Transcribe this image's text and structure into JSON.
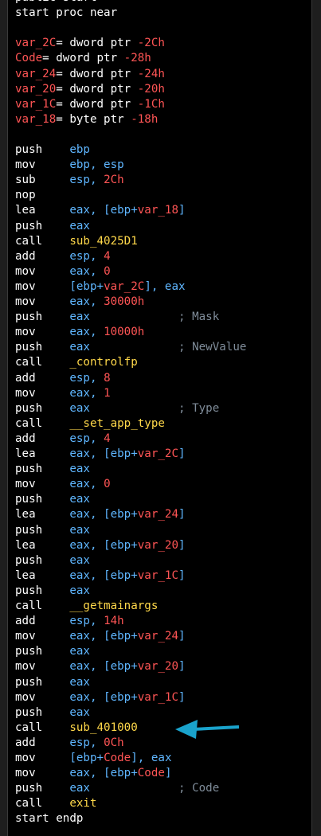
{
  "colors": {
    "background": "#000000",
    "text": "#ffffff",
    "variable": "#ff5555",
    "number": "#ff5555",
    "operand": "#5fb6ff",
    "function": "#ffd84a",
    "comment": "#7f8c99",
    "arrow": "#1aa3cc"
  },
  "lines": [
    [
      {
        "t": "public start",
        "c": "w"
      }
    ],
    [
      {
        "t": "start proc near",
        "c": "w"
      }
    ],
    [],
    [
      {
        "t": "var_2C",
        "c": "r"
      },
      {
        "t": "= dword ptr ",
        "c": "w"
      },
      {
        "t": "-2Ch",
        "c": "r"
      }
    ],
    [
      {
        "t": "Code",
        "c": "r"
      },
      {
        "t": "= dword ptr ",
        "c": "w"
      },
      {
        "t": "-28h",
        "c": "r"
      }
    ],
    [
      {
        "t": "var_24",
        "c": "r"
      },
      {
        "t": "= dword ptr ",
        "c": "w"
      },
      {
        "t": "-24h",
        "c": "r"
      }
    ],
    [
      {
        "t": "var_20",
        "c": "r"
      },
      {
        "t": "= dword ptr ",
        "c": "w"
      },
      {
        "t": "-20h",
        "c": "r"
      }
    ],
    [
      {
        "t": "var_1C",
        "c": "r"
      },
      {
        "t": "= dword ptr ",
        "c": "w"
      },
      {
        "t": "-1Ch",
        "c": "r"
      }
    ],
    [
      {
        "t": "var_18",
        "c": "r"
      },
      {
        "t": "= byte ptr ",
        "c": "w"
      },
      {
        "t": "-18h",
        "c": "r"
      }
    ],
    [],
    [
      {
        "t": "push    ",
        "c": "w"
      },
      {
        "t": "ebp",
        "c": "b"
      }
    ],
    [
      {
        "t": "mov     ",
        "c": "w"
      },
      {
        "t": "ebp, esp",
        "c": "b"
      }
    ],
    [
      {
        "t": "sub     ",
        "c": "w"
      },
      {
        "t": "esp, ",
        "c": "b"
      },
      {
        "t": "2Ch",
        "c": "r"
      }
    ],
    [
      {
        "t": "nop",
        "c": "w"
      }
    ],
    [
      {
        "t": "lea     ",
        "c": "w"
      },
      {
        "t": "eax, [ebp+",
        "c": "b"
      },
      {
        "t": "var_18",
        "c": "r"
      },
      {
        "t": "]",
        "c": "b"
      }
    ],
    [
      {
        "t": "push    ",
        "c": "w"
      },
      {
        "t": "eax",
        "c": "b"
      }
    ],
    [
      {
        "t": "call    ",
        "c": "w"
      },
      {
        "t": "sub_4025D1",
        "c": "y"
      }
    ],
    [
      {
        "t": "add     ",
        "c": "w"
      },
      {
        "t": "esp, ",
        "c": "b"
      },
      {
        "t": "4",
        "c": "r"
      }
    ],
    [
      {
        "t": "mov     ",
        "c": "w"
      },
      {
        "t": "eax, ",
        "c": "b"
      },
      {
        "t": "0",
        "c": "r"
      }
    ],
    [
      {
        "t": "mov     ",
        "c": "w"
      },
      {
        "t": "[ebp+",
        "c": "b"
      },
      {
        "t": "var_2C",
        "c": "r"
      },
      {
        "t": "], eax",
        "c": "b"
      }
    ],
    [
      {
        "t": "mov     ",
        "c": "w"
      },
      {
        "t": "eax, ",
        "c": "b"
      },
      {
        "t": "30000h",
        "c": "r"
      }
    ],
    [
      {
        "t": "push    ",
        "c": "w"
      },
      {
        "t": "eax",
        "c": "b"
      },
      {
        "t": "             ; Mask",
        "c": "g"
      }
    ],
    [
      {
        "t": "mov     ",
        "c": "w"
      },
      {
        "t": "eax, ",
        "c": "b"
      },
      {
        "t": "10000h",
        "c": "r"
      }
    ],
    [
      {
        "t": "push    ",
        "c": "w"
      },
      {
        "t": "eax",
        "c": "b"
      },
      {
        "t": "             ; NewValue",
        "c": "g"
      }
    ],
    [
      {
        "t": "call    ",
        "c": "w"
      },
      {
        "t": "_controlfp",
        "c": "y"
      }
    ],
    [
      {
        "t": "add     ",
        "c": "w"
      },
      {
        "t": "esp, ",
        "c": "b"
      },
      {
        "t": "8",
        "c": "r"
      }
    ],
    [
      {
        "t": "mov     ",
        "c": "w"
      },
      {
        "t": "eax, ",
        "c": "b"
      },
      {
        "t": "1",
        "c": "r"
      }
    ],
    [
      {
        "t": "push    ",
        "c": "w"
      },
      {
        "t": "eax",
        "c": "b"
      },
      {
        "t": "             ; Type",
        "c": "g"
      }
    ],
    [
      {
        "t": "call    ",
        "c": "w"
      },
      {
        "t": "__set_app_type",
        "c": "y"
      }
    ],
    [
      {
        "t": "add     ",
        "c": "w"
      },
      {
        "t": "esp, ",
        "c": "b"
      },
      {
        "t": "4",
        "c": "r"
      }
    ],
    [
      {
        "t": "lea     ",
        "c": "w"
      },
      {
        "t": "eax, [ebp+",
        "c": "b"
      },
      {
        "t": "var_2C",
        "c": "r"
      },
      {
        "t": "]",
        "c": "b"
      }
    ],
    [
      {
        "t": "push    ",
        "c": "w"
      },
      {
        "t": "eax",
        "c": "b"
      }
    ],
    [
      {
        "t": "mov     ",
        "c": "w"
      },
      {
        "t": "eax, ",
        "c": "b"
      },
      {
        "t": "0",
        "c": "r"
      }
    ],
    [
      {
        "t": "push    ",
        "c": "w"
      },
      {
        "t": "eax",
        "c": "b"
      }
    ],
    [
      {
        "t": "lea     ",
        "c": "w"
      },
      {
        "t": "eax, [ebp+",
        "c": "b"
      },
      {
        "t": "var_24",
        "c": "r"
      },
      {
        "t": "]",
        "c": "b"
      }
    ],
    [
      {
        "t": "push    ",
        "c": "w"
      },
      {
        "t": "eax",
        "c": "b"
      }
    ],
    [
      {
        "t": "lea     ",
        "c": "w"
      },
      {
        "t": "eax, [ebp+",
        "c": "b"
      },
      {
        "t": "var_20",
        "c": "r"
      },
      {
        "t": "]",
        "c": "b"
      }
    ],
    [
      {
        "t": "push    ",
        "c": "w"
      },
      {
        "t": "eax",
        "c": "b"
      }
    ],
    [
      {
        "t": "lea     ",
        "c": "w"
      },
      {
        "t": "eax, [ebp+",
        "c": "b"
      },
      {
        "t": "var_1C",
        "c": "r"
      },
      {
        "t": "]",
        "c": "b"
      }
    ],
    [
      {
        "t": "push    ",
        "c": "w"
      },
      {
        "t": "eax",
        "c": "b"
      }
    ],
    [
      {
        "t": "call    ",
        "c": "w"
      },
      {
        "t": "__getmainargs",
        "c": "y"
      }
    ],
    [
      {
        "t": "add     ",
        "c": "w"
      },
      {
        "t": "esp, ",
        "c": "b"
      },
      {
        "t": "14h",
        "c": "r"
      }
    ],
    [
      {
        "t": "mov     ",
        "c": "w"
      },
      {
        "t": "eax, [ebp+",
        "c": "b"
      },
      {
        "t": "var_24",
        "c": "r"
      },
      {
        "t": "]",
        "c": "b"
      }
    ],
    [
      {
        "t": "push    ",
        "c": "w"
      },
      {
        "t": "eax",
        "c": "b"
      }
    ],
    [
      {
        "t": "mov     ",
        "c": "w"
      },
      {
        "t": "eax, [ebp+",
        "c": "b"
      },
      {
        "t": "var_20",
        "c": "r"
      },
      {
        "t": "]",
        "c": "b"
      }
    ],
    [
      {
        "t": "push    ",
        "c": "w"
      },
      {
        "t": "eax",
        "c": "b"
      }
    ],
    [
      {
        "t": "mov     ",
        "c": "w"
      },
      {
        "t": "eax, [ebp+",
        "c": "b"
      },
      {
        "t": "var_1C",
        "c": "r"
      },
      {
        "t": "]",
        "c": "b"
      }
    ],
    [
      {
        "t": "push    ",
        "c": "w"
      },
      {
        "t": "eax",
        "c": "b"
      }
    ],
    [
      {
        "t": "call    ",
        "c": "w"
      },
      {
        "t": "sub_401000",
        "c": "y"
      }
    ],
    [
      {
        "t": "add     ",
        "c": "w"
      },
      {
        "t": "esp, ",
        "c": "b"
      },
      {
        "t": "0Ch",
        "c": "r"
      }
    ],
    [
      {
        "t": "mov     ",
        "c": "w"
      },
      {
        "t": "[ebp+",
        "c": "b"
      },
      {
        "t": "Code",
        "c": "r"
      },
      {
        "t": "], eax",
        "c": "b"
      }
    ],
    [
      {
        "t": "mov     ",
        "c": "w"
      },
      {
        "t": "eax, [ebp+",
        "c": "b"
      },
      {
        "t": "Code",
        "c": "r"
      },
      {
        "t": "]",
        "c": "b"
      }
    ],
    [
      {
        "t": "push    ",
        "c": "w"
      },
      {
        "t": "eax",
        "c": "b"
      },
      {
        "t": "             ; Code",
        "c": "g"
      }
    ],
    [
      {
        "t": "call    ",
        "c": "w"
      },
      {
        "t": "exit",
        "c": "y"
      }
    ],
    [
      {
        "t": "start endp",
        "c": "w"
      }
    ]
  ],
  "arrow": {
    "icon": "left-arrow-icon",
    "points_to": "sub_401000"
  }
}
